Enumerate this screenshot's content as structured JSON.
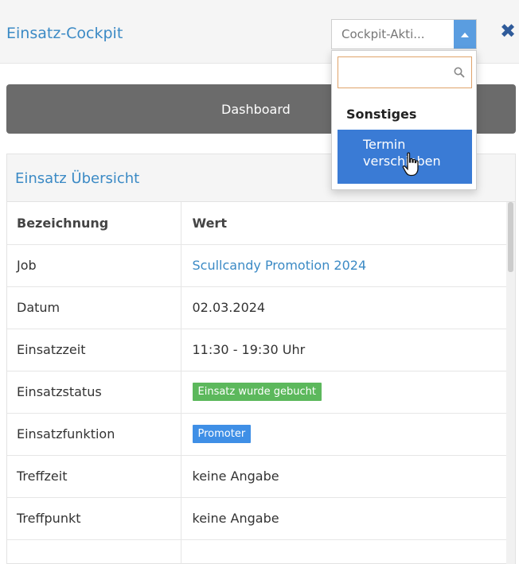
{
  "header": {
    "title": "Einsatz-Cockpit",
    "select": {
      "value": "Cockpit-Akti..."
    },
    "close_symbol": "✖"
  },
  "dashboard": {
    "label": "Dashboard"
  },
  "panel": {
    "title": "Einsatz Übersicht",
    "table": {
      "columns": [
        "Bezeichnung",
        "Wert"
      ],
      "rows": [
        {
          "key": "Job",
          "value": "Scullcandy Promotion 2024"
        },
        {
          "key": "Datum",
          "value": "02.03.2024"
        },
        {
          "key": "Einsatzzeit",
          "value": "11:30 - 19:30 Uhr"
        },
        {
          "key": "Einsatzstatus",
          "value": "Einsatz wurde gebucht"
        },
        {
          "key": "Einsatzfunktion",
          "value": "Promoter"
        },
        {
          "key": "Treffzeit",
          "value": "keine Angabe"
        },
        {
          "key": "Treffpunkt",
          "value": "keine Angabe"
        },
        {
          "key": "",
          "value": ""
        }
      ]
    }
  },
  "dropdown": {
    "search_value": "",
    "group_label": "Sonstiges",
    "options": [
      {
        "label_line1": "Termin",
        "label_line2": "verschieben"
      }
    ]
  },
  "colors": {
    "accent": "#3b8ac5",
    "select_arrow": "#5a9de0",
    "option_selected": "#3a7bd5",
    "dashboard_bar": "#6b6b6b",
    "badge_status": "#5cb85c",
    "badge_function": "#3f8fe6"
  },
  "icons": [
    "caret-up-icon",
    "close-icon",
    "search-icon",
    "hand-cursor-icon"
  ]
}
